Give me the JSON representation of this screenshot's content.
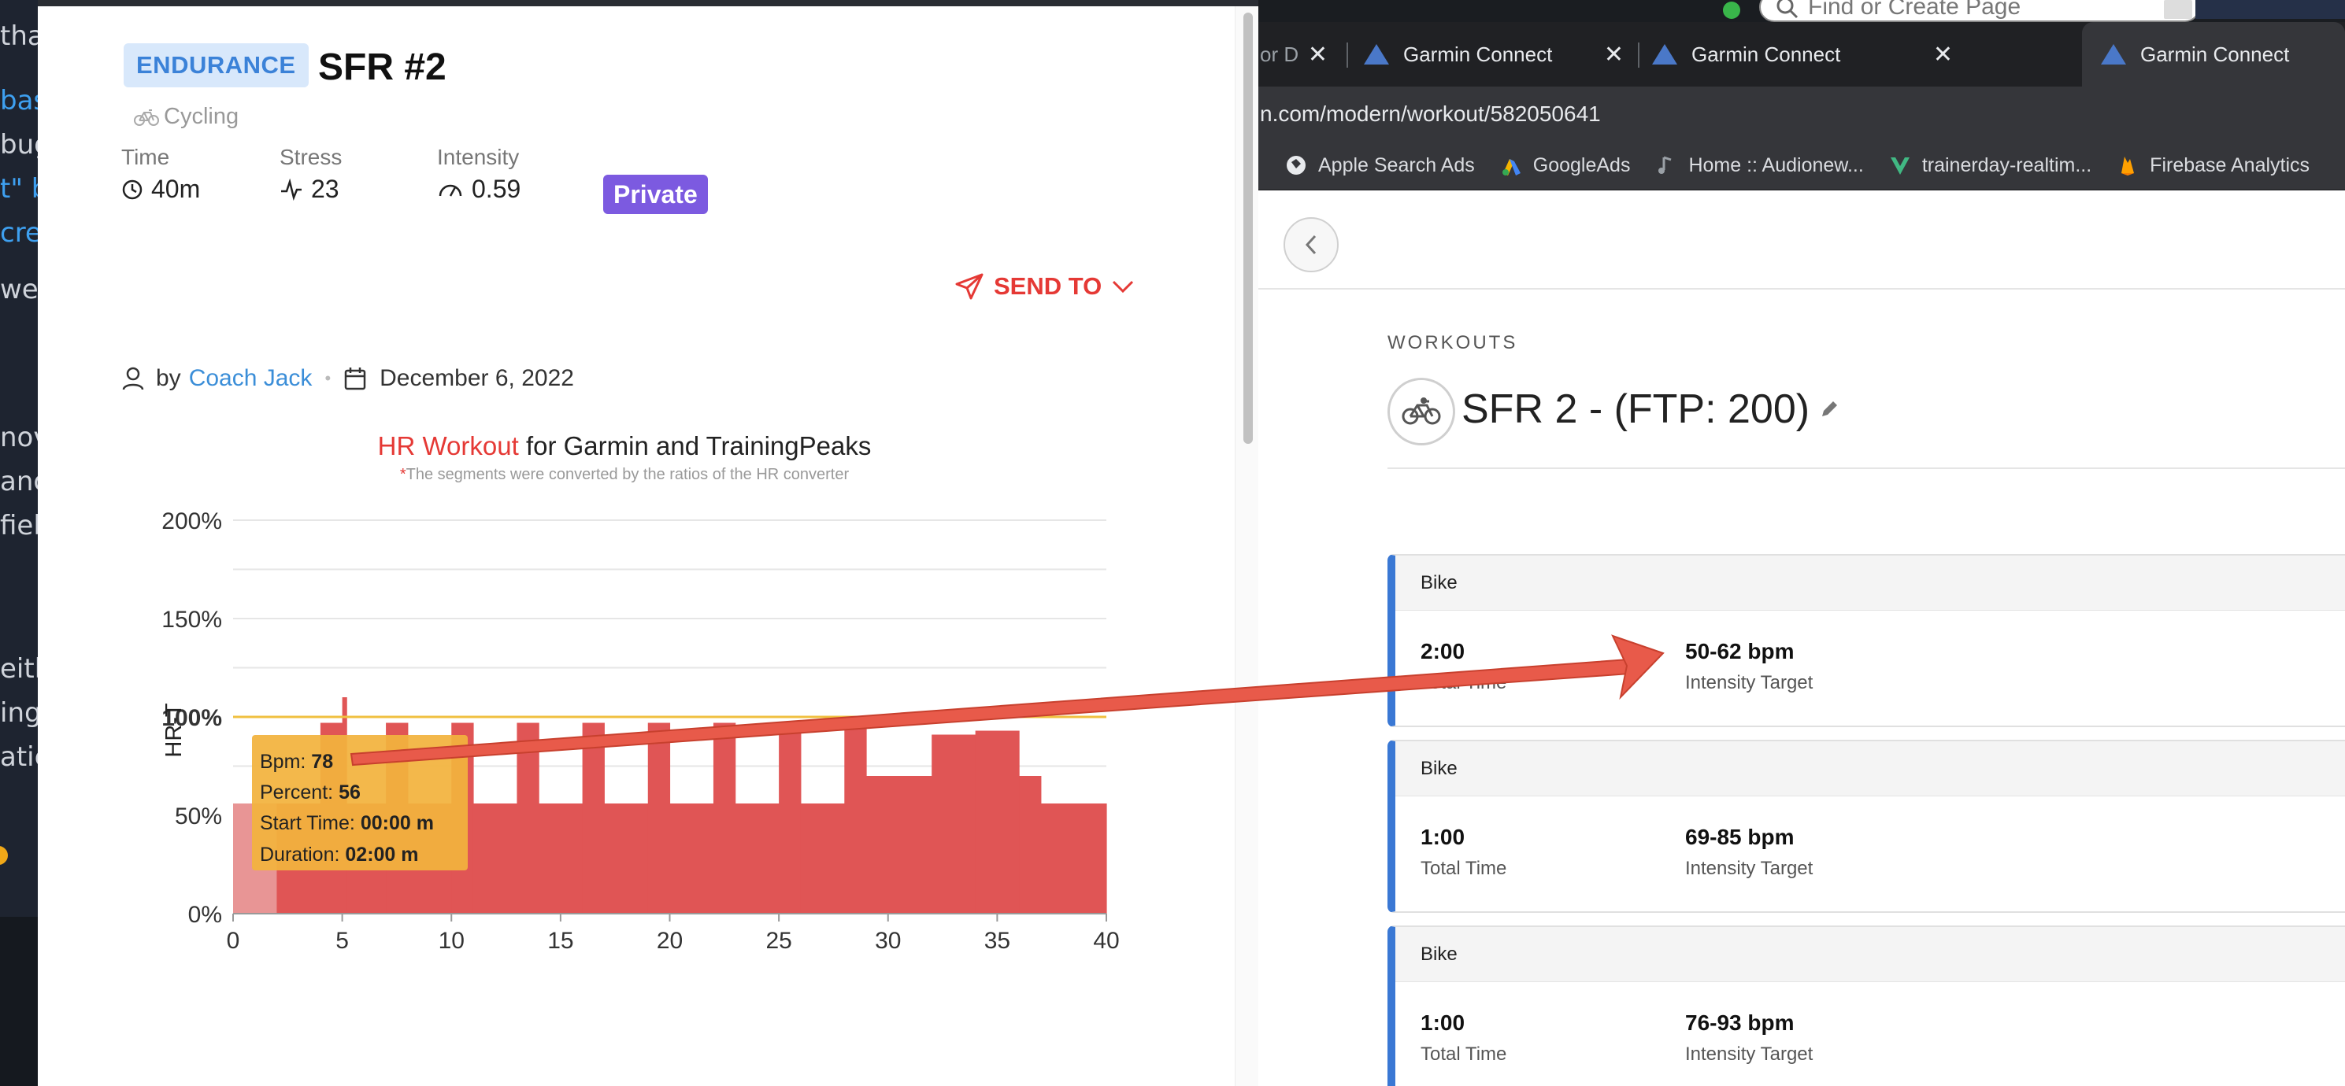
{
  "bg_editor": {
    "fragments": [
      "tha",
      "bas",
      "bug",
      "t\" b",
      "cre",
      "we",
      "nov",
      "and",
      "fiel",
      "eith",
      "ing",
      "atic"
    ]
  },
  "trainerday": {
    "category_badge": "ENDURANCE",
    "title": "SFR #2",
    "sport": "Cycling",
    "stats": {
      "time_label": "Time",
      "time_value": "40m",
      "stress_label": "Stress",
      "stress_value": "23",
      "intensity_label": "Intensity",
      "intensity_value": "0.59"
    },
    "privacy_badge": "Private",
    "send_to_label": "SEND TO",
    "author_prefix": "by",
    "author_name": "Coach Jack",
    "date": "December 6, 2022",
    "chart_title_highlight": "HR Workout",
    "chart_title_rest": " for Garmin and TrainingPeaks",
    "chart_note_mark": "*",
    "chart_note": "The segments were converted by the ratios of the HR converter",
    "tooltip": {
      "bpm_label": "Bpm: ",
      "bpm_value": "78",
      "percent_label": "Percent: ",
      "percent_value": "56",
      "start_label": "Start Time: ",
      "start_value": "00:00 m",
      "duration_label": "Duration: ",
      "duration_value": "02:00 m"
    },
    "colors": {
      "bar": "#e05555",
      "bar_highlight": "#e89595",
      "threshold": "#f0c040",
      "badge_blue": "#3b82d8",
      "private": "#7c5ae0",
      "send_to": "#e53935"
    }
  },
  "chart_data": {
    "type": "bar",
    "ylabel": "HR-T",
    "xlabel": "",
    "xlim": [
      0,
      40
    ],
    "ylim": [
      0,
      200
    ],
    "x_ticks": [
      0,
      5,
      10,
      15,
      20,
      25,
      30,
      35,
      40
    ],
    "y_ticks": [
      0,
      50,
      100,
      150,
      200
    ],
    "y_tick_labels": [
      "0%",
      "50%",
      "100%",
      "150%",
      "200%"
    ],
    "threshold": 100,
    "segments": [
      {
        "start": 0,
        "end": 2,
        "value": 56,
        "highlight": true
      },
      {
        "start": 2,
        "end": 4,
        "value": 56
      },
      {
        "start": 4,
        "end": 5,
        "value": 97
      },
      {
        "start": 5,
        "end": 5.2,
        "value": 110
      },
      {
        "start": 5.2,
        "end": 7,
        "value": 56
      },
      {
        "start": 7,
        "end": 8,
        "value": 97
      },
      {
        "start": 8,
        "end": 10,
        "value": 56
      },
      {
        "start": 10,
        "end": 11,
        "value": 97
      },
      {
        "start": 11,
        "end": 13,
        "value": 56
      },
      {
        "start": 13,
        "end": 14,
        "value": 97
      },
      {
        "start": 14,
        "end": 16,
        "value": 56
      },
      {
        "start": 16,
        "end": 17,
        "value": 97
      },
      {
        "start": 17,
        "end": 19,
        "value": 56
      },
      {
        "start": 19,
        "end": 20,
        "value": 97
      },
      {
        "start": 20,
        "end": 22,
        "value": 56
      },
      {
        "start": 22,
        "end": 23,
        "value": 97
      },
      {
        "start": 23,
        "end": 25,
        "value": 56
      },
      {
        "start": 25,
        "end": 26,
        "value": 97
      },
      {
        "start": 26,
        "end": 28,
        "value": 56
      },
      {
        "start": 28,
        "end": 29,
        "value": 97
      },
      {
        "start": 29,
        "end": 32,
        "value": 70
      },
      {
        "start": 32,
        "end": 34,
        "value": 91
      },
      {
        "start": 34,
        "end": 36,
        "value": 93
      },
      {
        "start": 36,
        "end": 37,
        "value": 70
      },
      {
        "start": 37,
        "end": 40,
        "value": 56
      }
    ]
  },
  "garmin": {
    "find_placeholder": "Find or Create Page",
    "tabs": [
      {
        "label": "or D",
        "active": false
      },
      {
        "label": "Garmin Connect",
        "active": false
      },
      {
        "label": "Garmin Connect",
        "active": false
      },
      {
        "label": "Garmin Connect",
        "active": true
      }
    ],
    "url_domain": "n.com",
    "url_path": "/modern/workout/582050641",
    "bookmarks": [
      "Apple Search Ads",
      "GoogleAds",
      "Home :: Audionew...",
      "trainerday-realtim...",
      "Firebase Analytics"
    ],
    "section_label": "WORKOUTS",
    "workout_name": "SFR 2 - (FTP: 200)",
    "steps": [
      {
        "type": "Bike",
        "time": "2:00",
        "time_label": "Total Time",
        "target": "50-62 bpm",
        "target_label": "Intensity Target"
      },
      {
        "type": "Bike",
        "time": "1:00",
        "time_label": "Total Time",
        "target": "69-85 bpm",
        "target_label": "Intensity Target"
      },
      {
        "type": "Bike",
        "time": "1:00",
        "time_label": "Total Time",
        "target": "76-93 bpm",
        "target_label": "Intensity Target"
      }
    ],
    "colors": {
      "step_accent": "#3a78d4",
      "tab_icon": "#4a78c8"
    }
  },
  "annotation": {
    "arrow_color": "#e85a4a"
  }
}
